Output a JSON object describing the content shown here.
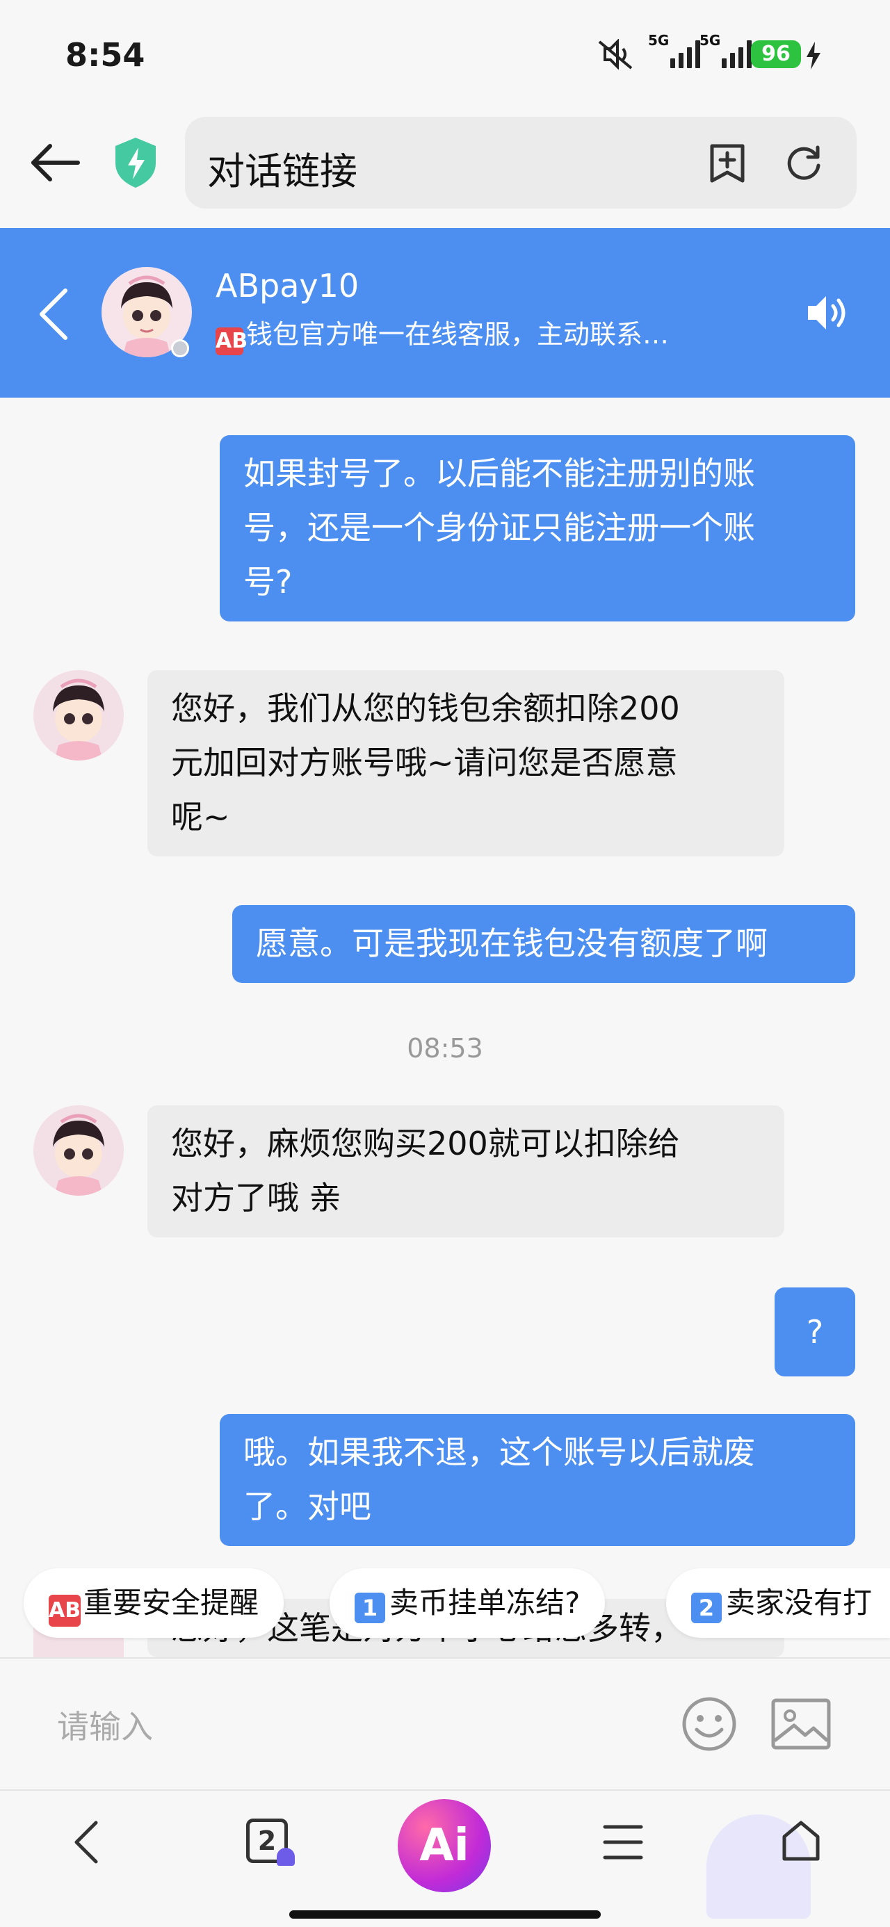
{
  "status_bar": {
    "time": "8:54",
    "signal_labels": [
      "5G",
      "5G"
    ],
    "battery": "96",
    "icons": [
      "mute-icon",
      "signal-icon",
      "signal-icon",
      "battery-icon",
      "charging-icon"
    ]
  },
  "browser": {
    "url_text": "对话链接",
    "icons": [
      "back-arrow-icon",
      "shield-icon",
      "bookmark-add-icon",
      "refresh-icon"
    ]
  },
  "chat_header": {
    "name": "ABpay10",
    "badge": "AB",
    "description": "钱包官方唯一在线客服，主动联系…",
    "icons": [
      "back-chevron-icon",
      "speaker-icon"
    ]
  },
  "messages": [
    {
      "side": "out",
      "lines": [
        "如果封号了。以后能不能注册别的账",
        "号，还是一个身份证只能注册一个账",
        "号?"
      ]
    },
    {
      "side": "in",
      "lines": [
        "您好，我们从您的钱包余额扣除200",
        "元加回对方账号哦~请问您是否愿意",
        "呢~"
      ]
    },
    {
      "side": "out",
      "lines": [
        "愿意。可是我现在钱包没有额度了啊"
      ]
    },
    {
      "side": "in",
      "lines": [
        "您好，麻烦您购买200就可以扣除给",
        "对方了哦 亲"
      ]
    },
    {
      "side": "out",
      "lines": [
        "?"
      ]
    },
    {
      "side": "out",
      "lines": [
        "哦。如果我不退，这个账号以后就废",
        "了。对吧"
      ]
    },
    {
      "side": "in",
      "lines": [
        "您好，这笔是对方不小心给您多转，"
      ]
    }
  ],
  "timestamp": "08:53",
  "quick_replies": [
    {
      "badge": "AB",
      "label": "重要安全提醒"
    },
    {
      "badge": "1",
      "label": "卖币挂单冻结?"
    },
    {
      "badge": "2",
      "label": "卖家没有打"
    }
  ],
  "input": {
    "placeholder": "请输入",
    "icons": [
      "emoji-icon",
      "image-icon"
    ]
  },
  "bottom_nav": {
    "tab_count": "2",
    "ai_label": "Ai",
    "icons": [
      "back-chevron-icon",
      "tabs-icon",
      "ai-icon",
      "menu-icon",
      "home-icon"
    ]
  }
}
